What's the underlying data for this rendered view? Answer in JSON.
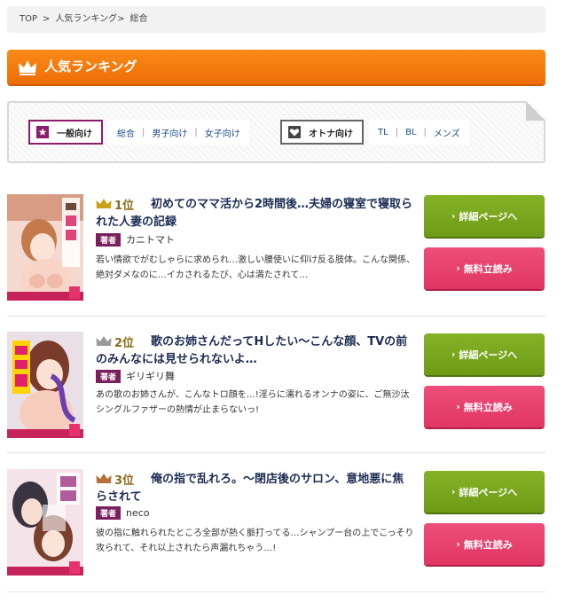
{
  "breadcrumb": {
    "top": "TOP",
    "sep": ">",
    "ranking": "人気ランキング",
    "sep2": ">",
    "current": "総合"
  },
  "header": {
    "title": "人気ランキング"
  },
  "filters": {
    "general_label": "一般向け",
    "general_links": [
      "総合",
      "男子向け",
      "女子向け"
    ],
    "adult_label": "オトナ向け",
    "adult_links": [
      "TL",
      "BL",
      "メンズ"
    ]
  },
  "author_label": "著者",
  "buttons": {
    "detail": "詳細ページへ",
    "read": "無料立読み"
  },
  "items": [
    {
      "rank": "1位",
      "title": "初めてのママ活から2時間後…夫婦の寝室で寝取られた人妻の記録",
      "author": "カニトマト",
      "desc": "若い情欲でがむしゃらに求められ…激しい腰使いに仰け反る肢体。こんな関係、絶対ダメなのに…イカされるたび、心は満たされて…",
      "crown": "#c9a21a"
    },
    {
      "rank": "2位",
      "title": "歌のお姉さんだってHしたい～こんな顔、TVの前のみんなには見せられないよ…",
      "author": "ギリギリ舞",
      "desc": "あの歌のお姉さんが、こんなトロ顔を…!淫らに濡れるオンナの姿に、ご無沙汰シングルファザーの熱情が止まらないっ!",
      "crown": "#9a9a9a"
    },
    {
      "rank": "3位",
      "title": "俺の指で乱れろ。～閉店後のサロン、意地悪に焦らされて",
      "author": "neco",
      "desc": "彼の指に触れられたところ全部が熱く脈打ってる…シャンプー台の上でこっそり攻られて、それ以上されたら声漏れちゃう…!",
      "crown": "#b5713a"
    }
  ]
}
